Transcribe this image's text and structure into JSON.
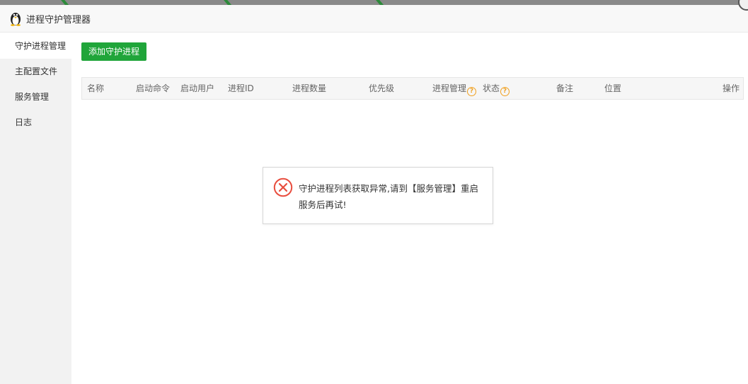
{
  "window": {
    "title": "进程守护管理器"
  },
  "sidebar": {
    "items": [
      {
        "label": "守护进程管理",
        "active": true
      },
      {
        "label": "主配置文件",
        "active": false
      },
      {
        "label": "服务管理",
        "active": false
      },
      {
        "label": "日志",
        "active": false
      }
    ]
  },
  "toolbar": {
    "add_label": "添加守护进程"
  },
  "table": {
    "columns": [
      "名称",
      "启动命令",
      "启动用户",
      "进程ID",
      "进程数量",
      "优先级",
      "进程管理",
      "状态",
      "备注",
      "位置",
      "操作"
    ]
  },
  "toast": {
    "message": "守护进程列表获取异常,请到【服务管理】重启服务后再试!"
  },
  "colors": {
    "accent_green": "#20a53a",
    "error_red": "#e84c3d",
    "help_orange": "#f0a020"
  }
}
